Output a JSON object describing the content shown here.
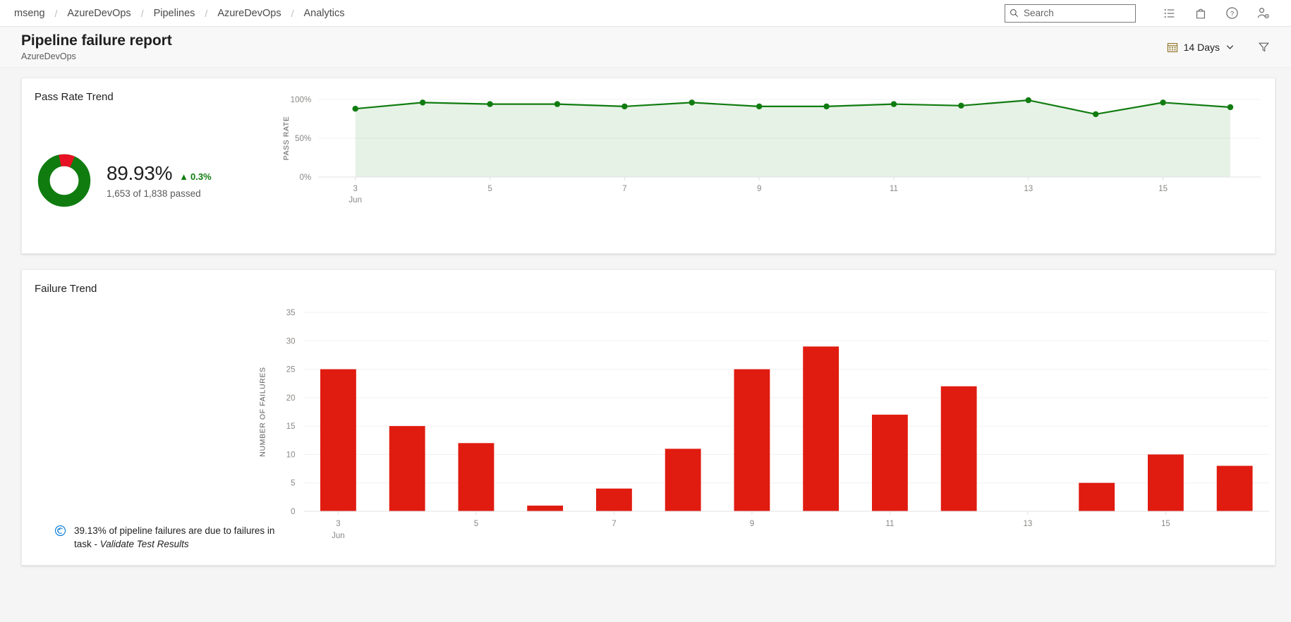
{
  "topbar": {
    "breadcrumb": [
      {
        "label": "mseng"
      },
      {
        "label": "AzureDevOps"
      },
      {
        "label": "Pipelines"
      },
      {
        "label": "AzureDevOps"
      },
      {
        "label": "Analytics"
      }
    ],
    "separator": "/",
    "search": {
      "placeholder": "Search",
      "value": ""
    },
    "icons": [
      {
        "name": "work-items-icon"
      },
      {
        "name": "marketplace-bag-icon"
      },
      {
        "name": "help-icon"
      },
      {
        "name": "user-settings-icon"
      }
    ]
  },
  "header": {
    "title": "Pipeline failure report",
    "subtitle": "AzureDevOps",
    "date_range_label": "14 Days",
    "calendar_icon": "calendar-icon",
    "chevron_icon": "chevron-down-icon",
    "filter_icon": "filter-funnel-icon"
  },
  "pass_rate_card": {
    "title": "Pass Rate Trend",
    "percent": "89.93%",
    "delta": "0.3%",
    "delta_arrow": "▲",
    "summary": "1,653 of 1,838 passed",
    "pass_color": "#107c10",
    "fail_color": "#e81123",
    "pass_fraction": 0.8993
  },
  "failure_card": {
    "title": "Failure Trend",
    "insight_icon": "insight-icon",
    "insight_text_1": "39.13% of pipeline failures are due to failures in task - ",
    "insight_text_2": "Validate Test Results"
  },
  "chart_data": [
    {
      "type": "area",
      "id": "pass-rate-trend",
      "title": "Pass Rate Trend",
      "xlabel": "",
      "ylabel": "PASS RATE",
      "ylim": [
        0,
        100
      ],
      "yticks": [
        "0%",
        "50%",
        "100%"
      ],
      "ytick_values": [
        0,
        50,
        100
      ],
      "grid": true,
      "legend": "none",
      "line_color": "#107c10",
      "fill_color": "#107c10",
      "x": [
        3,
        4,
        5,
        6,
        7,
        8,
        9,
        10,
        11,
        12,
        13,
        14,
        15,
        16
      ],
      "xtick_labels": [
        "3",
        "5",
        "7",
        "9",
        "11",
        "13",
        "15"
      ],
      "xtick_values": [
        3,
        5,
        7,
        9,
        11,
        13,
        15
      ],
      "xaxis_month": "Jun",
      "values": [
        88,
        96,
        94,
        94,
        91,
        96,
        91,
        91,
        94,
        92,
        99,
        81,
        96,
        90
      ]
    },
    {
      "type": "bar",
      "id": "failure-trend",
      "title": "Failure Trend",
      "xlabel": "",
      "ylabel": "NUMBER OF FAILURES",
      "ylim": [
        0,
        35
      ],
      "yticks": [
        "0",
        "5",
        "10",
        "15",
        "20",
        "25",
        "30",
        "35"
      ],
      "ytick_values": [
        0,
        5,
        10,
        15,
        20,
        25,
        30,
        35
      ],
      "grid": true,
      "legend": "none",
      "bar_color": "#e01b10",
      "categories": [
        "3",
        "4",
        "5",
        "6",
        "7",
        "8",
        "9",
        "10",
        "11",
        "12",
        "13",
        "14",
        "15",
        "16"
      ],
      "xtick_labels": [
        "3",
        "5",
        "7",
        "9",
        "11",
        "13",
        "15"
      ],
      "xtick_values": [
        3,
        5,
        7,
        9,
        11,
        13,
        15
      ],
      "xaxis_month": "Jun",
      "values": [
        25,
        15,
        12,
        1,
        4,
        11,
        25,
        29,
        17,
        22,
        0,
        5,
        10,
        8
      ]
    }
  ]
}
